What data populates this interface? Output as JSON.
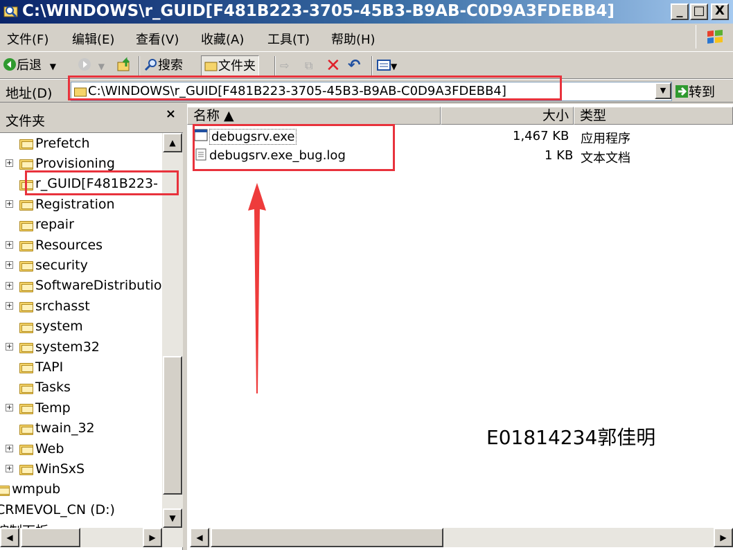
{
  "window": {
    "title": "C:\\WINDOWS\\r_GUID[F481B223-3705-45B3-B9AB-C0D9A3FDEBB4]",
    "minimize": "_",
    "maximize": "□",
    "close": "X"
  },
  "menu": [
    "文件(F)",
    "编辑(E)",
    "查看(V)",
    "收藏(A)",
    "工具(T)",
    "帮助(H)"
  ],
  "toolbar": {
    "back": "后退",
    "search": "搜索",
    "folders": "文件夹"
  },
  "address": {
    "label": "地址(D)",
    "value": "C:\\WINDOWS\\r_GUID[F481B223-3705-45B3-B9AB-C0D9A3FDEBB4]",
    "go": "转到"
  },
  "folders_pane": {
    "title": "文件夹",
    "close": "×",
    "items": [
      {
        "label": "Prefetch",
        "expandable": false,
        "indent": 1
      },
      {
        "label": "Provisioning",
        "expandable": true,
        "indent": 1
      },
      {
        "label": "r_GUID[F481B223-",
        "expandable": false,
        "indent": 1,
        "selected": true
      },
      {
        "label": "Registration",
        "expandable": true,
        "indent": 1
      },
      {
        "label": "repair",
        "expandable": false,
        "indent": 1
      },
      {
        "label": "Resources",
        "expandable": true,
        "indent": 1
      },
      {
        "label": "security",
        "expandable": true,
        "indent": 1
      },
      {
        "label": "SoftwareDistributio",
        "expandable": true,
        "indent": 1
      },
      {
        "label": "srchasst",
        "expandable": true,
        "indent": 1
      },
      {
        "label": "system",
        "expandable": false,
        "indent": 1
      },
      {
        "label": "system32",
        "expandable": true,
        "indent": 1
      },
      {
        "label": "TAPI",
        "expandable": false,
        "indent": 1
      },
      {
        "label": "Tasks",
        "expandable": false,
        "indent": 1
      },
      {
        "label": "Temp",
        "expandable": true,
        "indent": 1
      },
      {
        "label": "twain_32",
        "expandable": false,
        "indent": 1
      },
      {
        "label": "Web",
        "expandable": true,
        "indent": 1
      },
      {
        "label": "WinSxS",
        "expandable": true,
        "indent": 1
      },
      {
        "label": "wmpub",
        "expandable": false,
        "indent": 0
      },
      {
        "label": "CRMEVOL_CN (D:)",
        "expandable": false,
        "indent": 0
      },
      {
        "label": "控制面板",
        "expandable": false,
        "indent": 0
      }
    ]
  },
  "columns": {
    "name": "名称 ▲",
    "size": "大小",
    "type": "类型"
  },
  "files": [
    {
      "name": "debugsrv.exe",
      "size": "1,467 KB",
      "type": "应用程序"
    },
    {
      "name": "debugsrv.exe_bug.log",
      "size": "1 KB",
      "type": "文本文档"
    }
  ],
  "watermark": "E01814234郭佳明",
  "colors": {
    "annotation_red": "#e8323c",
    "title_blue": "#0a246a"
  }
}
